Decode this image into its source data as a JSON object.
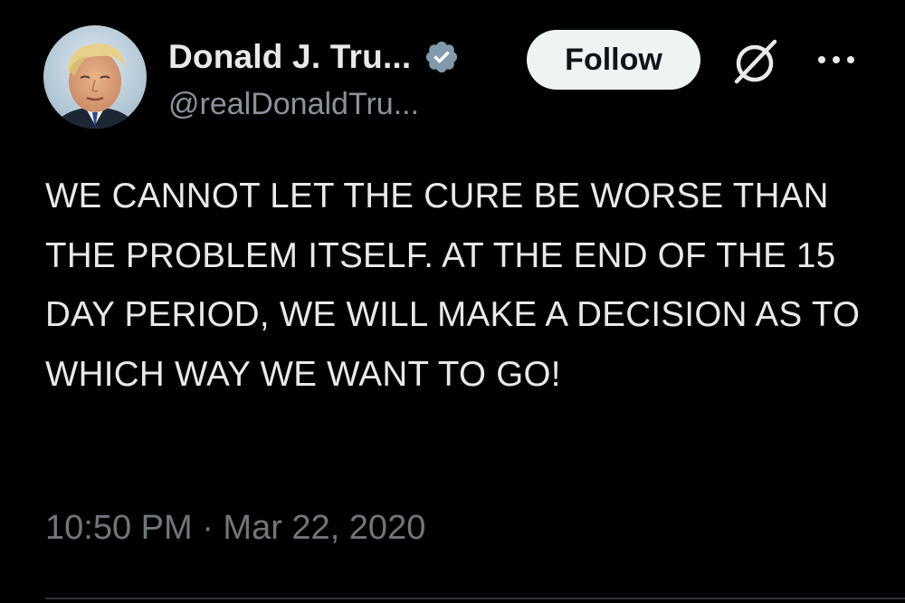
{
  "tweet": {
    "author": {
      "display_name": "Donald J. Tru...",
      "handle": "@realDonaldTru...",
      "verified": true,
      "avatar_icon": "profile-photo"
    },
    "follow_label": "Follow",
    "grok_icon": "grok-icon",
    "more_icon": "more-options-icon",
    "text": "WE CANNOT LET THE CURE BE WORSE THAN THE PROBLEM ITSELF. AT THE END OF THE 15 DAY PERIOD, WE WILL MAKE A DECISION AS TO WHICH WAY WE WANT TO GO!",
    "timestamp": "10:50 PM · Mar 22, 2020"
  },
  "colors": {
    "background": "#000000",
    "primary_text": "#e7e9ea",
    "secondary_text": "#71767b",
    "verified_badge": "#829aab",
    "follow_bg": "#eff3f4",
    "follow_text": "#0f1419"
  }
}
